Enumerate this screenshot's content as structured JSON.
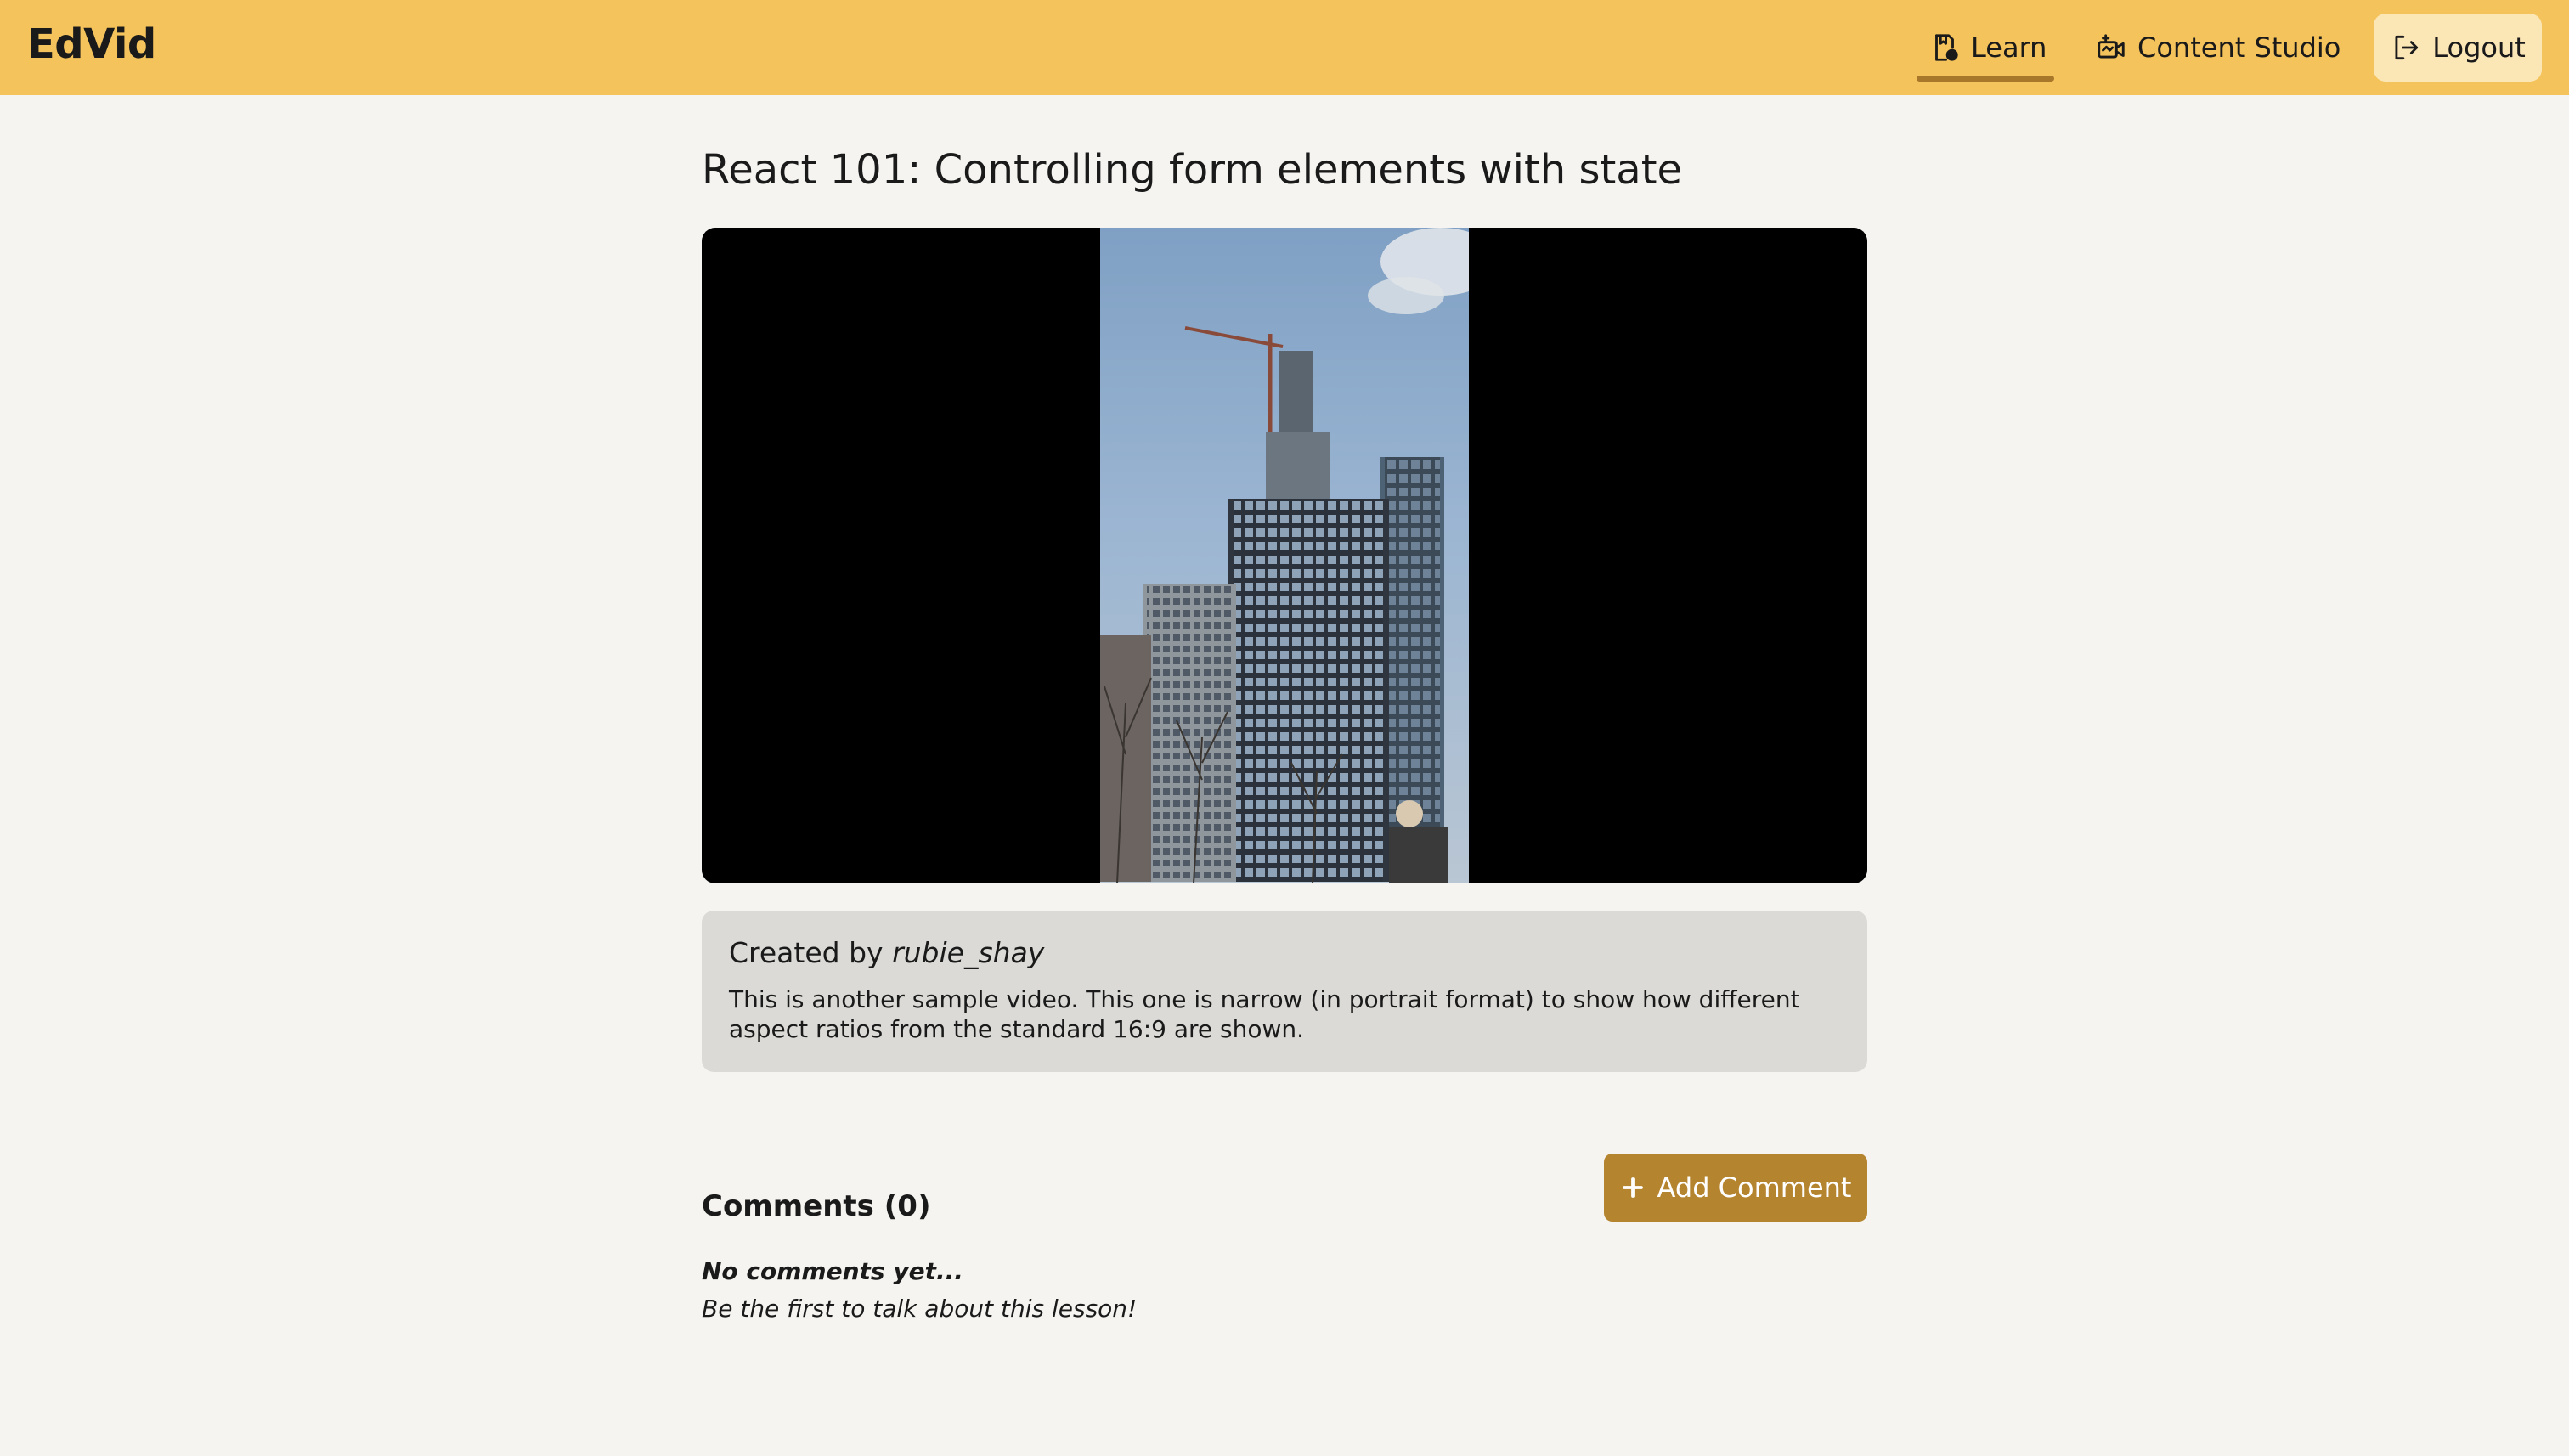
{
  "header": {
    "brand": "EdVid",
    "nav": [
      {
        "label": "Learn",
        "icon": "learn-icon",
        "active": true
      },
      {
        "label": "Content Studio",
        "icon": "video-camera-icon",
        "active": false
      }
    ],
    "logout_label": "Logout",
    "logout_icon": "logout-icon",
    "background_color": "#f5c35b",
    "active_underline_color": "#a9772a"
  },
  "lesson": {
    "title": "React 101: Controlling form elements with state",
    "created_by_prefix": "Created by",
    "author": "rubie_shay",
    "description": "This is another sample video. This one is narrow (in portrait format) to show how different aspect ratios from the standard 16:9 are shown."
  },
  "comments": {
    "title": "Comments (0)",
    "add_button_label": "Add Comment",
    "add_button_color": "#b5842f",
    "empty_title": "No comments yet...",
    "empty_subtitle": "Be the first to talk about this lesson!"
  }
}
